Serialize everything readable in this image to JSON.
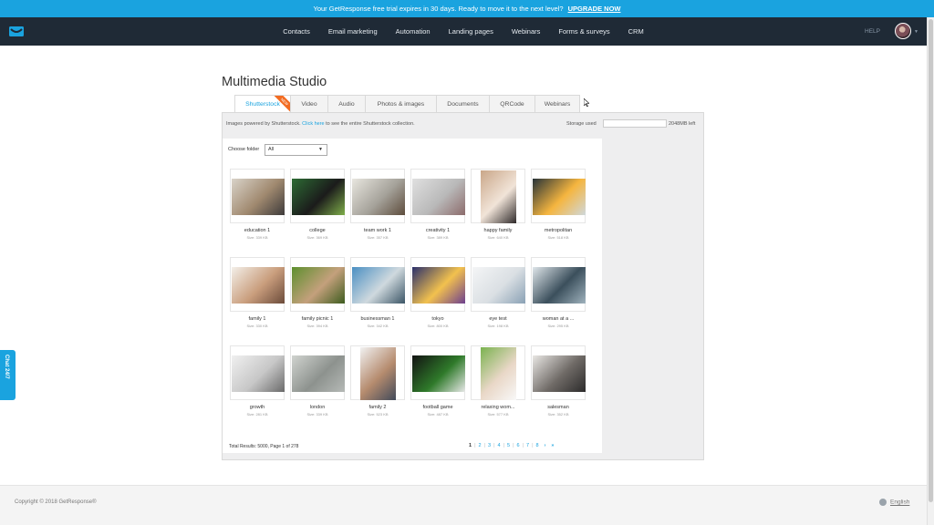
{
  "banner": {
    "text": "Your GetResponse free trial expires in 30 days. Ready to move it to the next level?",
    "upgrade_label": "UPGRADE NOW"
  },
  "nav": {
    "items": [
      "Contacts",
      "Email marketing",
      "Automation",
      "Landing pages",
      "Webinars",
      "Forms & surveys",
      "CRM"
    ],
    "help_label": "HELP"
  },
  "chat": {
    "label": "Chat 24/7"
  },
  "page": {
    "title": "Multimedia Studio"
  },
  "tabs": [
    {
      "label": "Shutterstock",
      "active": true,
      "badge": "NEW"
    },
    {
      "label": "Video"
    },
    {
      "label": "Audio"
    },
    {
      "label": "Photos & images"
    },
    {
      "label": "Documents"
    },
    {
      "label": "QRCode"
    },
    {
      "label": "Webinars"
    }
  ],
  "info": {
    "prefix": "Images powered by Shutterstock.",
    "link": "Click here",
    "suffix": "to see the entire Shutterstock collection.",
    "storage_label": "Storage used",
    "storage_left": "2048MB left"
  },
  "folder": {
    "label": "Choose folder",
    "value": "All"
  },
  "images": [
    {
      "name": "education 1",
      "size": "Size: 339 KB",
      "colors": [
        "#d9d3c9",
        "#a0896f",
        "#3d3a3a"
      ]
    },
    {
      "name": "college",
      "size": "Size: 369 KB",
      "colors": [
        "#2d6b34",
        "#1b1b1b",
        "#7fae4a"
      ]
    },
    {
      "name": "team work 1",
      "size": "Size: 357 KB",
      "colors": [
        "#e8e6df",
        "#a5a29a",
        "#5d4c3c"
      ]
    },
    {
      "name": "creativity 1",
      "size": "Size: 389 KB",
      "colors": [
        "#e0e0e0",
        "#b9b9b9",
        "#8c6b6b"
      ]
    },
    {
      "name": "happy family",
      "size": "Size: 640 KB",
      "colors": [
        "#c9a688",
        "#f1e4d8",
        "#2f2a2a"
      ]
    },
    {
      "name": "metropolitan",
      "size": "Size: 518 KB",
      "colors": [
        "#263238",
        "#f5b53f",
        "#cfd8dc"
      ]
    },
    {
      "name": "family 1",
      "size": "Size: 330 KB",
      "colors": [
        "#f3efe9",
        "#c99d7c",
        "#6b4b3a"
      ]
    },
    {
      "name": "family picnic 1",
      "size": "Size: 394 KB",
      "colors": [
        "#5d8f2e",
        "#c4a07c",
        "#3d5c1f"
      ]
    },
    {
      "name": "businessman 1",
      "size": "Size: 342 KB",
      "colors": [
        "#4a8fc2",
        "#cfd9de",
        "#3b5566"
      ]
    },
    {
      "name": "tokyo",
      "size": "Size: 800 KB",
      "colors": [
        "#2a2f6b",
        "#f2c14e",
        "#6d3f8f"
      ]
    },
    {
      "name": "eye test",
      "size": "Size: 198 KB",
      "colors": [
        "#f4f5f6",
        "#dadfe3",
        "#8aa1b5"
      ]
    },
    {
      "name": "woman at a ...",
      "size": "Size: 295 KB",
      "colors": [
        "#dfe6ea",
        "#3b4f5c",
        "#9fb2bd"
      ]
    },
    {
      "name": "growth",
      "size": "Size: 281 KB",
      "colors": [
        "#f0f0f0",
        "#c7c7c7",
        "#6a6a6a"
      ]
    },
    {
      "name": "london",
      "size": "Size: 339 KB",
      "colors": [
        "#d0d3cf",
        "#8d928e",
        "#b5b9b6"
      ]
    },
    {
      "name": "family 2",
      "size": "Size: 523 KB",
      "colors": [
        "#f1f1f1",
        "#b58b6e",
        "#424a5a"
      ]
    },
    {
      "name": "football game",
      "size": "Size: 487 KB",
      "colors": [
        "#121212",
        "#2f7a2a",
        "#e8e8e8"
      ]
    },
    {
      "name": "relaxing wom...",
      "size": "Size: 577 KB",
      "colors": [
        "#7ab24f",
        "#e9d7c7",
        "#f8f8f8"
      ]
    },
    {
      "name": "salesman",
      "size": "Size: 352 KB",
      "colors": [
        "#e9e7e4",
        "#6f6a66",
        "#2c2b2b"
      ]
    }
  ],
  "results": {
    "text": "Total Results: 5000, Page 1 of 278"
  },
  "pager": {
    "pages": [
      "1",
      "2",
      "3",
      "4",
      "5",
      "6",
      "7",
      "8"
    ],
    "next": "›",
    "last": "»"
  },
  "footer": {
    "copyright": "Copyright © 2018 GetResponse®",
    "language": "English"
  },
  "colors": {
    "accent": "#1aa3df",
    "navbar": "#1f2a36",
    "badge": "#f26b21"
  }
}
